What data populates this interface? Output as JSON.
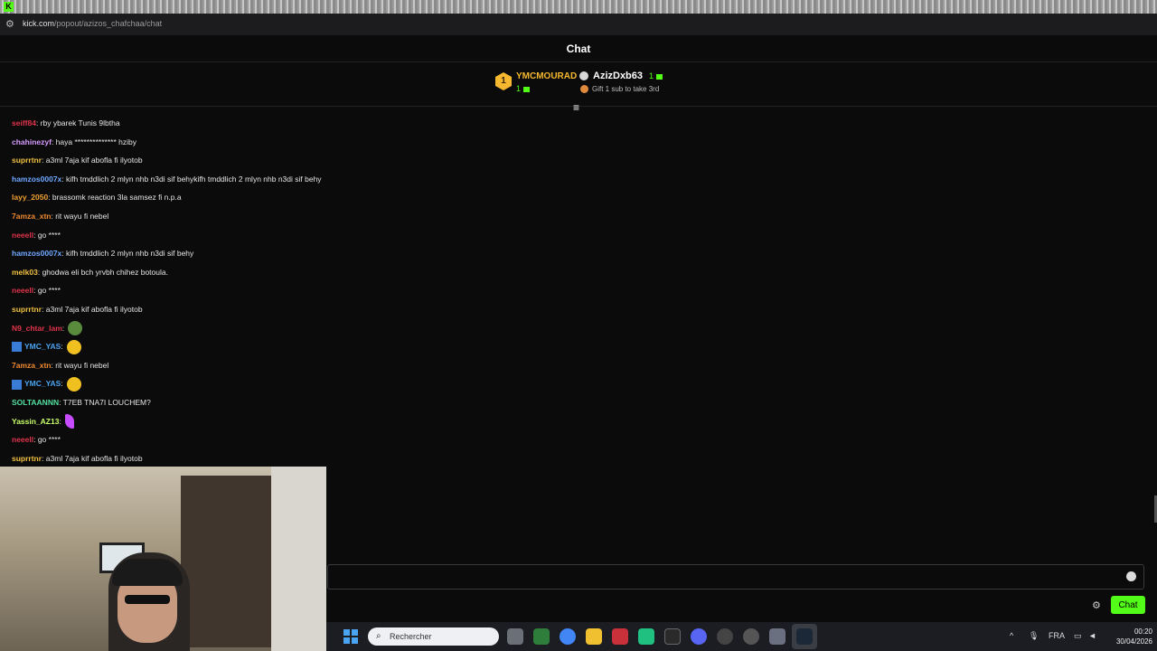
{
  "browser": {
    "url_host": "kick.com",
    "url_path": "/popout/azizos_chafchaa/chat"
  },
  "header": {
    "title": "Chat"
  },
  "leaderboard": {
    "first": {
      "rank": "1",
      "name": "YMCMOURAD",
      "count": "1",
      "color": "#f5b82e"
    },
    "second": {
      "name": "AzizDxb63",
      "count": "1"
    },
    "third": {
      "text": "Gift 1 sub to take 3rd"
    }
  },
  "messages": [
    {
      "user": "seiff84",
      "color": "#e0344a",
      "text": ": rby ybarek Tunis 9lbtha"
    },
    {
      "user": "chahinezyf",
      "color": "#d79cff",
      "text": ": haya ************** hziby"
    },
    {
      "user": "suprrtnr",
      "color": "#f0c040",
      "text": ": a3ml 7aja kif abofla fi ilyotob"
    },
    {
      "user": "hamzos0007x",
      "color": "#6fa8ff",
      "text": ": kifh tmddlich 2 mlyn nhb n3di sif behykifh tmddlich 2 mlyn nhb n3di sif behy"
    },
    {
      "user": "layy_2050",
      "color": "#f0a030",
      "text": ": brassomk reaction 3la samsez fi n.p.a"
    },
    {
      "user": "7amza_xtn",
      "color": "#f08a30",
      "text": ": rit wayu fi nebel"
    },
    {
      "user": "neeell",
      "color": "#e0344a",
      "text": ": go ****"
    },
    {
      "user": "hamzos0007x",
      "color": "#6fa8ff",
      "text": ": kifh tmddlich 2 mlyn nhb n3di sif behy"
    },
    {
      "user": "melk03",
      "color": "#f0c040",
      "text": ": ghodwa eli bch yrvbh chihez botoula."
    },
    {
      "user": "neeell",
      "color": "#e0344a",
      "text": ": go ****"
    },
    {
      "user": "suprrtnr",
      "color": "#f0c040",
      "text": ": a3ml 7aja kif abofla fi ilyotob"
    },
    {
      "user": "N9_chtar_lam",
      "color": "#e0344a",
      "text": ":"
    },
    {
      "user": "YMC_YAS",
      "color": "#4aa3f0",
      "text": ":"
    },
    {
      "user": "7amza_xtn",
      "color": "#f08a30",
      "text": ": rit wayu fi nebel"
    },
    {
      "user": "YMC_YAS",
      "color": "#4aa3f0",
      "text": ":"
    },
    {
      "user": "SOLTAANNN",
      "color": "#53e0a0",
      "text": ": T7EB TNA7I LOUCHEM?"
    },
    {
      "user": "Yassin_AZ13",
      "color": "#c8ff6a",
      "text": ":"
    },
    {
      "user": "neeell",
      "color": "#e0344a",
      "text": ": go ****"
    },
    {
      "user": "suprrtnr",
      "color": "#f0c040",
      "text": ": a3ml 7aja kif abofla fi ilyotob"
    }
  ],
  "composer": {
    "placeholder": "",
    "send_label": "Chat"
  },
  "taskbar": {
    "search_placeholder": "Rechercher",
    "language": "FRA",
    "time": "00:20",
    "date": "30/04/2026"
  },
  "colors": {
    "accent": "#53fc18"
  }
}
